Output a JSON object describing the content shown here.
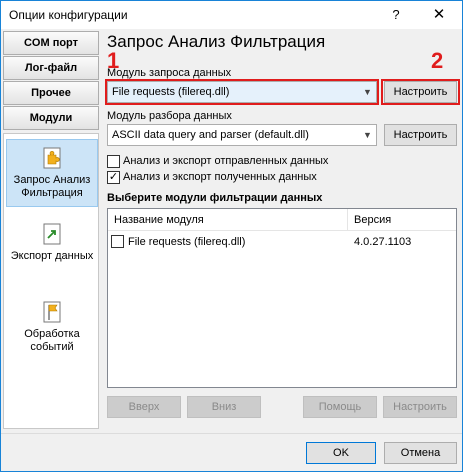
{
  "window": {
    "title": "Опции конфигурации",
    "help_glyph": "?",
    "close_glyph": "✕"
  },
  "sidebar": {
    "buttons": [
      "COM порт",
      "Лог-файл",
      "Прочее",
      "Модули"
    ],
    "items": [
      {
        "label": "Запрос Анализ Фильтрация",
        "icon": "puzzle-icon",
        "selected": true
      },
      {
        "label": "Экспорт данных",
        "icon": "export-icon",
        "selected": false
      },
      {
        "label": "Обработка событий",
        "icon": "flag-icon",
        "selected": false
      }
    ]
  },
  "main": {
    "heading": "Запрос Анализ Фильтрация",
    "markers": [
      "1",
      "2"
    ],
    "query_module": {
      "label": "Модуль запроса данных",
      "value": "File requests (filereq.dll)",
      "configure_label": "Настроить"
    },
    "parser_module": {
      "label": "Модуль разбора данных",
      "value": "ASCII data query and parser (default.dll)",
      "configure_label": "Настроить"
    },
    "checkboxes": [
      {
        "label": "Анализ и экспорт отправленных данных",
        "checked": false
      },
      {
        "label": "Анализ и экспорт полученных данных",
        "checked": true
      }
    ],
    "filter_title": "Выберите модули фильтрации данных",
    "filter_table": {
      "columns": [
        "Название модуля",
        "Версия"
      ],
      "rows": [
        {
          "name": "File requests (filereq.dll)",
          "version": "4.0.27.1103",
          "checked": false
        }
      ]
    },
    "list_buttons": [
      "Вверх",
      "Вниз",
      "Помощь",
      "Настроить"
    ]
  },
  "footer": {
    "ok_label": "OK",
    "cancel_label": "Отмена"
  },
  "colors": {
    "accent": "#0078d7",
    "marker_red": "#e01c1c",
    "selection": "#cce4f7"
  }
}
